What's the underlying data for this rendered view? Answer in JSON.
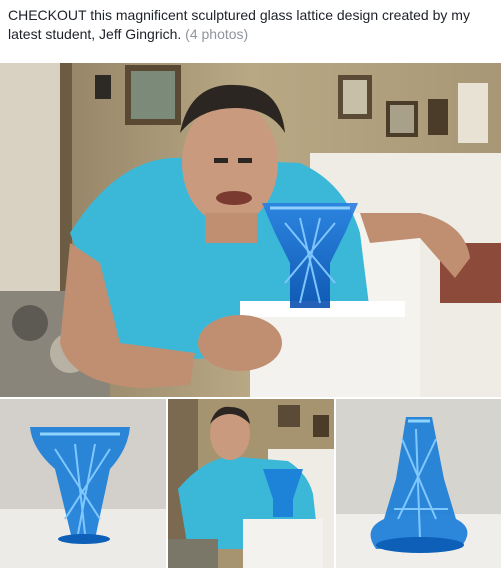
{
  "post": {
    "caption": "CHECKOUT this magnificent sculptured glass lattice design created by my latest student, Jeff Gingrich.",
    "photo_count": "(4 photos)"
  },
  "photos": [
    {
      "alt": "man-holding-blue-glass-vase"
    },
    {
      "alt": "blue-glass-lattice-vase-side"
    },
    {
      "alt": "man-with-vase-on-pedestal"
    },
    {
      "alt": "blue-glass-lattice-vase-front"
    }
  ],
  "colors": {
    "text": "#1d2129",
    "muted": "#90949c",
    "shirt": "#3bb8d8",
    "glass": "#1e6fd0"
  }
}
